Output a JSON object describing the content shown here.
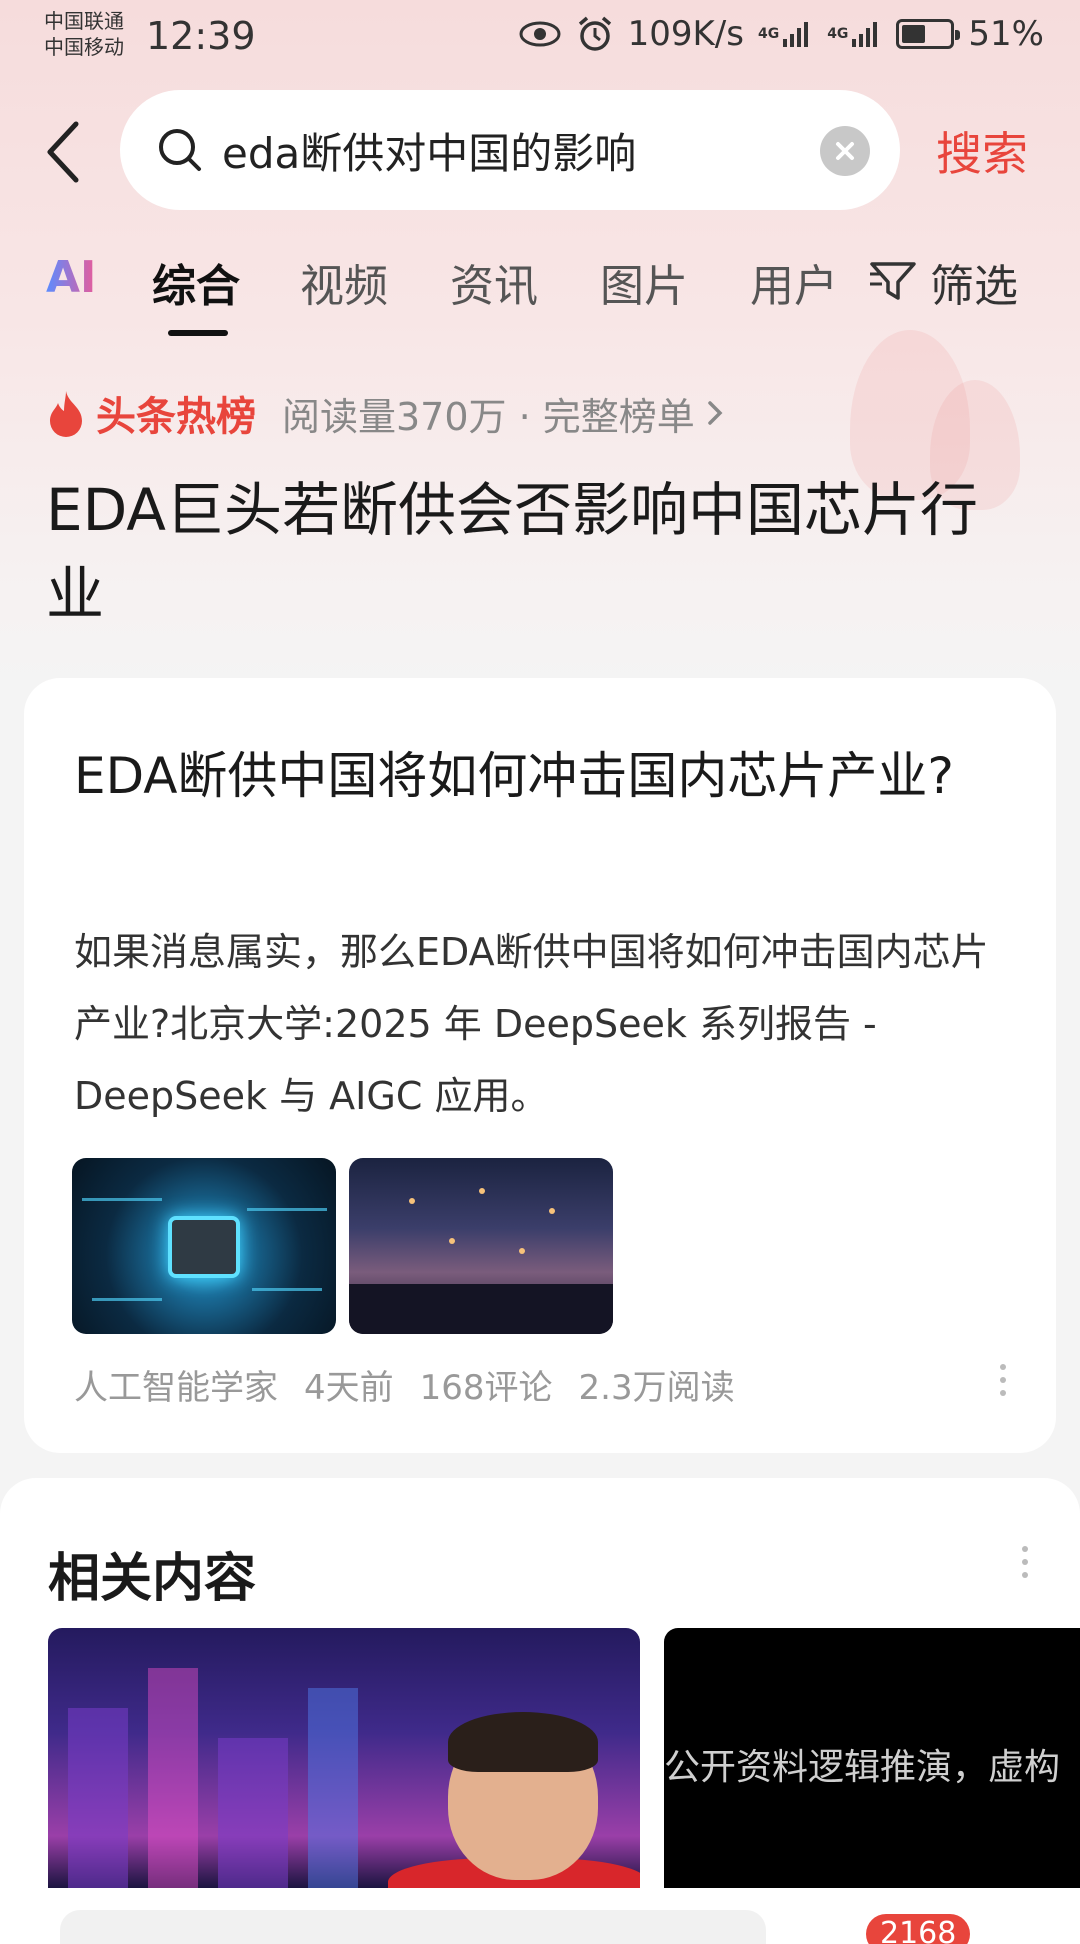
{
  "status_bar": {
    "carrier_1": "中国联通",
    "carrier_2": "中国移动",
    "time": "12:39",
    "net_speed": "109K/s",
    "signal_1": "4G",
    "signal_2": "4G",
    "battery_percent": "51%",
    "battery_level": 0.51,
    "icons": [
      "eye-icon",
      "alarm-icon",
      "signal-icon",
      "battery-icon"
    ]
  },
  "search": {
    "query": "eda断供对中国的影响",
    "search_button": "搜索"
  },
  "tabs": {
    "ai": "AI",
    "items": [
      "综合",
      "视频",
      "资讯",
      "图片",
      "用户"
    ],
    "active": "综合",
    "filter": "筛选"
  },
  "hot_list": {
    "label": "头条热榜",
    "meta": "阅读量370万 · 完整榜单",
    "title": "EDA巨头若断供会否影响中国芯片行业"
  },
  "result_card": {
    "title": "EDA断供中国将如何冲击国内芯片产业?",
    "description": "如果消息属实，那么EDA断供中国将如何冲击国内芯片产业?北京大学:2025 年 DeepSeek 系列报告 - DeepSeek 与 AIGC 应用。",
    "source": "人工智能学家",
    "time": "4天前",
    "comments": "168评论",
    "reads": "2.3万阅读"
  },
  "related": {
    "title": "相关内容",
    "video2_caption": "公开资料逻辑推演，虚构",
    "comment_badge": "2168"
  },
  "colors": {
    "accent": "#e8453c",
    "header_bg": "#f6dcdc"
  }
}
